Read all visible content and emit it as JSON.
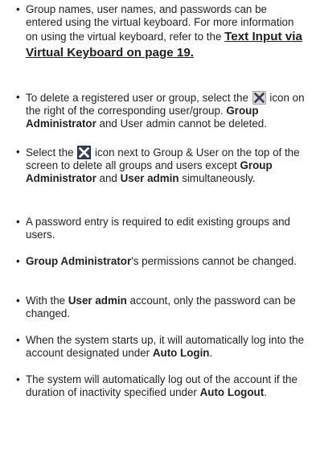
{
  "bullet": "•",
  "notes": [
    {
      "t1": "Group names, user names, and passwords can be entered using the virtual keyboard. For more information on using the virtual keyboard, refer to the ",
      "link": "Text Input via Virtual Keyboard on page 19."
    },
    {
      "t1": "To delete a registered user or group, select the ",
      "icon": "delete-x-icon",
      "t2": " icon on the right of the corresponding user/group. ",
      "b1": "Group Administrator",
      "t3": " and User admin cannot be deleted."
    },
    {
      "t1": "Select the ",
      "icon": "delete-all-x-icon",
      "t2": " icon next to Group & User on the top of the screen to delete all groups and users except ",
      "b1": "Group Administrator",
      "t3": " and ",
      "b2": "User admin",
      "t4": " simultaneously."
    },
    {
      "t1": "A password entry is required to edit existing groups and users."
    },
    {
      "b1": "Group Administrator",
      "t1": "'s permissions cannot be changed."
    },
    {
      "t1": "With the ",
      "b1": "User admin",
      "t2": " account, only the password can be changed."
    },
    {
      "t1": "When the system starts up, it will automatically log into the account designated under ",
      "b1": "Auto Login",
      "t2": "."
    },
    {
      "t1": "The system will automatically log out of the account if the duration of inactivity specified under ",
      "b1": "Auto Logout",
      "t2": "."
    }
  ],
  "colors": {
    "text": "#231f20",
    "icon_light_bg": "#d9d9d9",
    "icon_light_x": "#3a3f4c",
    "icon_dark_bg": "#33415f",
    "icon_dark_x": "#ffffff"
  }
}
